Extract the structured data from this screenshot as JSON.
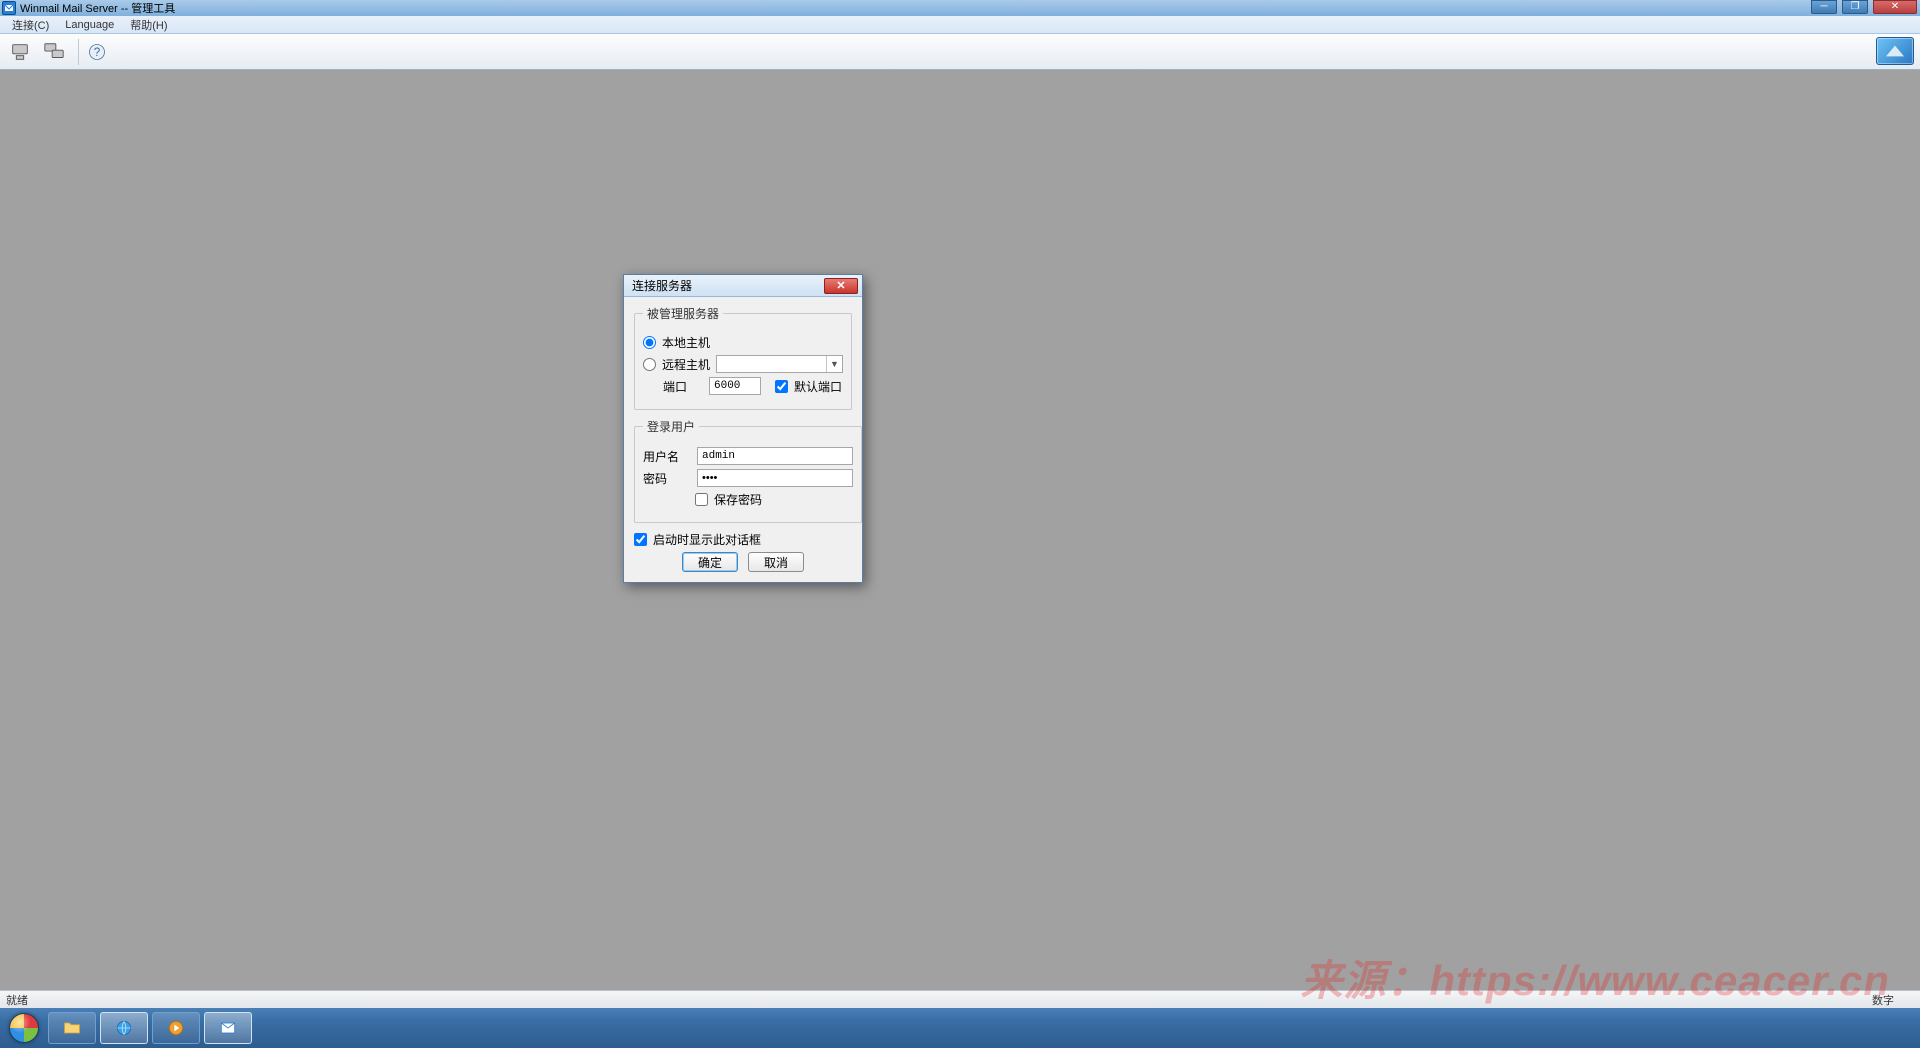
{
  "window": {
    "title": "Winmail Mail Server -- 管理工具"
  },
  "menubar": {
    "connect": "连接(C)",
    "language": "Language",
    "help": "帮助(H)"
  },
  "status": {
    "ready": "就绪",
    "numlock": "数字"
  },
  "dialog": {
    "title": "连接服务器",
    "group_server": "被管理服务器",
    "radio_local": "本地主机",
    "radio_remote": "远程主机",
    "port_label": "端口",
    "port_value": "6000",
    "default_port": "默认端口",
    "group_login": "登录用户",
    "user_label": "用户名",
    "user_value": "admin",
    "pass_label": "密码",
    "pass_value": "••••",
    "save_pass": "保存密码",
    "show_on_start": "启动时显示此对话框",
    "ok": "确定",
    "cancel": "取消"
  },
  "watermark": "来源：https://www.ceacer.cn"
}
